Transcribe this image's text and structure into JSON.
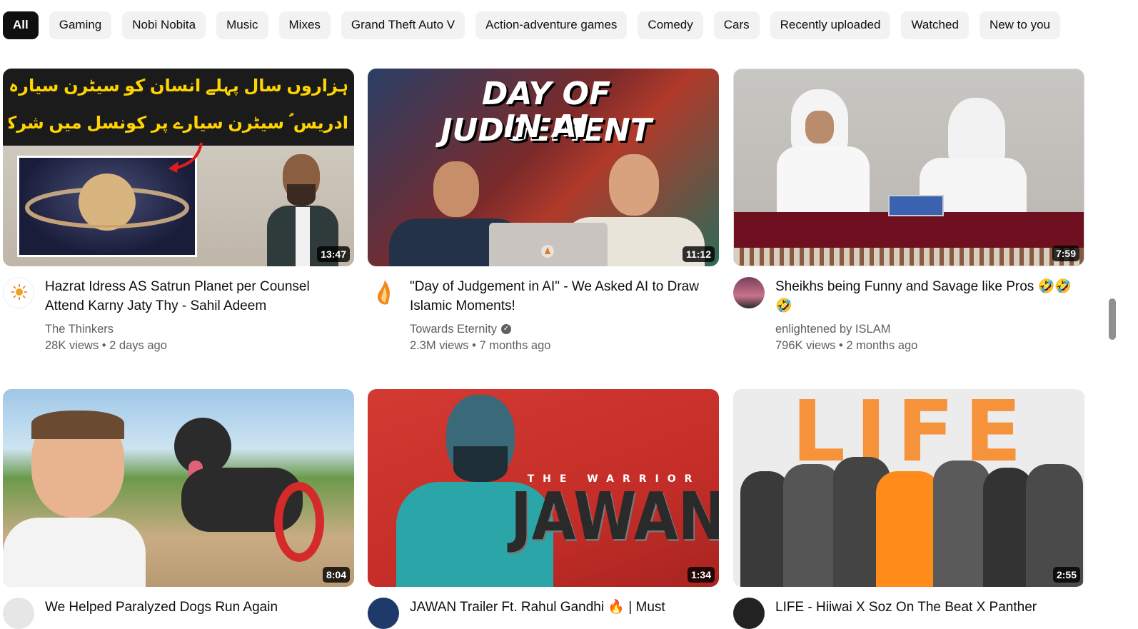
{
  "chips": [
    "All",
    "Gaming",
    "Nobi Nobita",
    "Music",
    "Mixes",
    "Grand Theft Auto V",
    "Action-adventure games",
    "Comedy",
    "Cars",
    "Recently uploaded",
    "Watched",
    "New to you"
  ],
  "videos": [
    {
      "title": "Hazrat Idress AS Satrun Planet per Counsel Attend Karny Jaty Thy - Sahil Adeem",
      "channel": "The Thinkers",
      "stats": "28K views • 2 days ago",
      "duration": "13:47",
      "thumb_text_line1": "ہزاروں سال پہلے انسان کو سیٹرن سیارہ آنکھ سے نظر آتا تھا",
      "thumb_text_line2": "ادریس ؑ سیٹرن سیارے پر کونسل میں شرکت کرنے جاتے تھے"
    },
    {
      "title": "\"Day of Judgement in AI\" - We Asked AI to Draw Islamic Moments!",
      "channel": "Towards Eternity",
      "stats": "2.3M views • 7 months ago",
      "duration": "11:12",
      "thumb_text_line1": "DAY OF JUDGEMENT",
      "thumb_text_line2": "IN AI"
    },
    {
      "title": "Sheikhs being Funny and Savage like Pros 🤣🤣🤣",
      "channel": "enlightened by ISLAM",
      "stats": "796K views • 2 months ago",
      "duration": "7:59"
    },
    {
      "title": "We Helped Paralyzed Dogs Run Again",
      "channel": "",
      "stats": "",
      "duration": "8:04"
    },
    {
      "title": "JAWAN Trailer Ft. Rahul Gandhi 🔥 | Must",
      "channel": "",
      "stats": "",
      "duration": "1:34",
      "thumb_text_line1": "THE WARRIOR",
      "thumb_text_line2": "JAWAN"
    },
    {
      "title": "LIFE - Hiiwai X Soz On The Beat X Panther",
      "channel": "",
      "stats": "",
      "duration": "2:55",
      "thumb_text_line1": "LIFE"
    }
  ],
  "colors": {
    "chip_bg": "#f2f2f2",
    "chip_active_bg": "#0f0f0f",
    "meta_text": "#606060"
  }
}
